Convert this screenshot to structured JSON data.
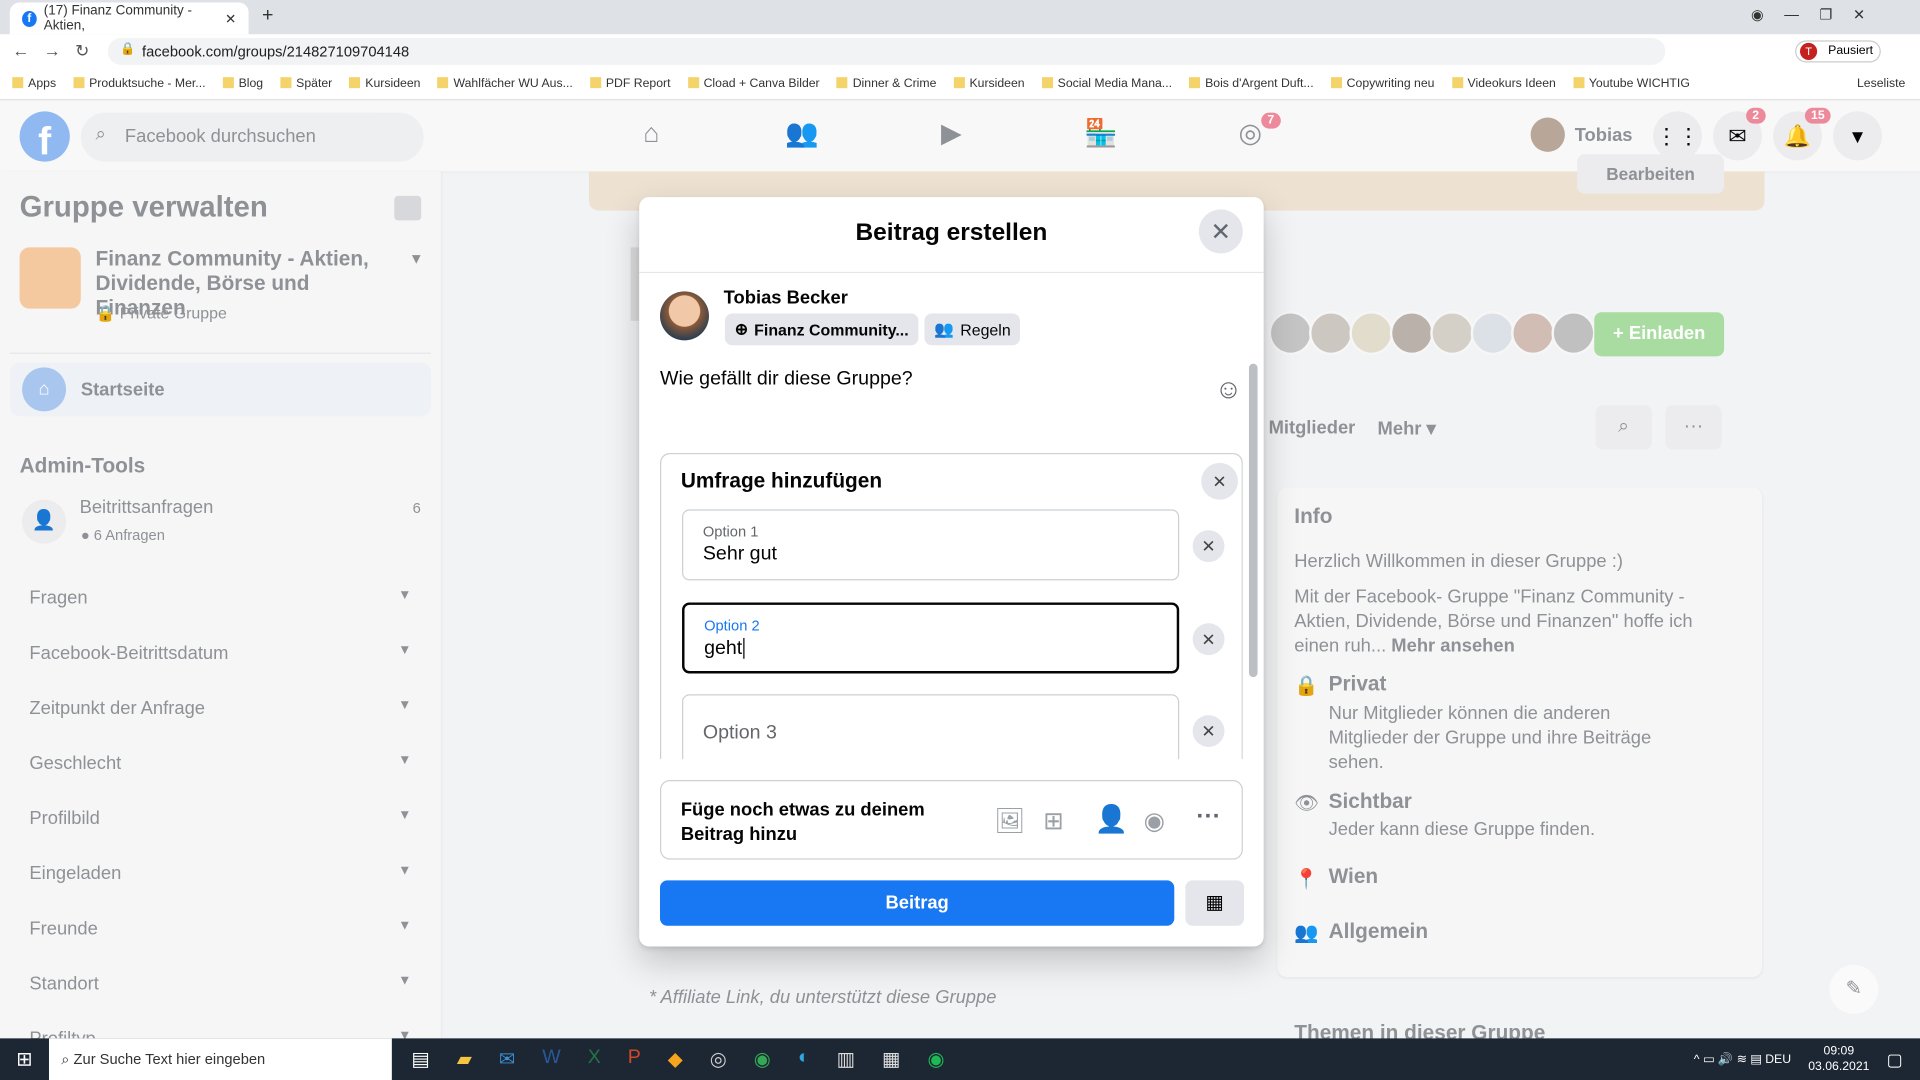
{
  "browser": {
    "tab_title": "(17) Finanz Community - Aktien,",
    "url": "facebook.com/groups/214827109704148",
    "profile_label": "Pausiert",
    "bookmarks": [
      "Apps",
      "Produktsuche - Mer...",
      "Blog",
      "Später",
      "Kursideen",
      "Wahlfächer WU Aus...",
      "PDF Report",
      "Cload + Canva Bilder",
      "Dinner & Crime",
      "Kursideen",
      "Social Media Mana...",
      "Bois d'Argent Duft...",
      "Copywriting neu",
      "Videokurs Ideen",
      "Youtube WICHTIG"
    ],
    "reading_list": "Leseliste"
  },
  "fb": {
    "search_placeholder": "Facebook durchsuchen",
    "groups_badge": "7",
    "user_name": "Tobias",
    "messenger_badge": "2",
    "notifications_badge": "15"
  },
  "sidebar": {
    "title": "Gruppe verwalten",
    "group_name": "Finanz Community - Aktien, Dividende, Börse und Finanzen",
    "group_privacy": "Private Gruppe",
    "home": "Startseite",
    "admin_tools": "Admin-Tools",
    "requests": {
      "label": "Beitrittsanfragen",
      "sub": "6 Anfragen",
      "count": "6"
    },
    "filters": [
      "Fragen",
      "Facebook-Beitrittsdatum",
      "Zeitpunkt der Anfrage",
      "Geschlecht",
      "Profilbild",
      "Eingeladen",
      "Freunde",
      "Standort",
      "Profiltyp"
    ]
  },
  "main": {
    "edit_label": "Bearbeiten",
    "invite_label": "Einladen",
    "tab_members": "Mitglieder",
    "tab_more": "Mehr",
    "affiliate": "* Affiliate Link, du unterstützt diese Gruppe",
    "info": {
      "title": "Info",
      "welcome": "Herzlich Willkommen in dieser Gruppe :)",
      "desc": "Mit der Facebook- Gruppe \"Finanz Community - Aktien, Dividende, Börse und Finanzen\" hoffe ich einen ruh...",
      "more": "Mehr ansehen",
      "private_title": "Privat",
      "private_desc": "Nur Mitglieder können die anderen Mitglieder der Gruppe und ihre Beiträge sehen.",
      "visible_title": "Sichtbar",
      "visible_desc": "Jeder kann diese Gruppe finden.",
      "location": "Wien",
      "category": "Allgemein",
      "topics": "Themen in dieser Gruppe"
    }
  },
  "modal": {
    "title": "Beitrag erstellen",
    "author": "Tobias Becker",
    "audience": "Finanz Community...",
    "rules": "Regeln",
    "question": "Wie gefällt dir diese Gruppe?",
    "poll": {
      "title": "Umfrage hinzufügen",
      "options": [
        {
          "label": "Option 1",
          "value": "Sehr gut"
        },
        {
          "label": "Option 2",
          "value": "geht"
        },
        {
          "placeholder": "Option 3"
        }
      ]
    },
    "add_to_post": "Füge noch etwas zu deinem Beitrag hinzu",
    "post_button": "Beitrag",
    "accent": "#1877f2"
  },
  "taskbar": {
    "search_placeholder": "Zur Suche Text hier eingeben",
    "language": "DEU",
    "time": "09:09",
    "date": "03.06.2021"
  }
}
